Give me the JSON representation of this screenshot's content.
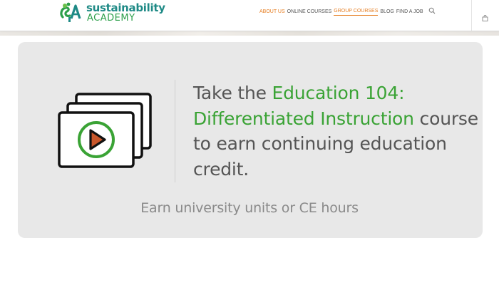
{
  "logo": {
    "line1": "sustainability",
    "line2": "ACADEMY",
    "icon": "tree-logo-icon"
  },
  "nav": {
    "items": [
      {
        "label": "ABOUT US",
        "color": "#e67e22"
      },
      {
        "label": "ONLINE COURSES",
        "color": "#555555"
      },
      {
        "label": "GROUP COURSES",
        "color": "#e67e22"
      },
      {
        "label": "BLOG",
        "color": "#555555"
      },
      {
        "label": "FIND A JOB",
        "color": "#555555"
      }
    ],
    "search_icon": "search-icon",
    "cart_icon": "cart-icon"
  },
  "promo": {
    "icon": "video-stack-icon",
    "headline_prefix": "Take the ",
    "course_name": "Education 104: Differentiated Instruction",
    "headline_suffix": " course to earn continuing education credit.",
    "subtext": "Earn university units or CE hours"
  },
  "colors": {
    "accent_green": "#3aa335",
    "accent_orange": "#e67e22",
    "card_bg": "#e8e8e8"
  }
}
